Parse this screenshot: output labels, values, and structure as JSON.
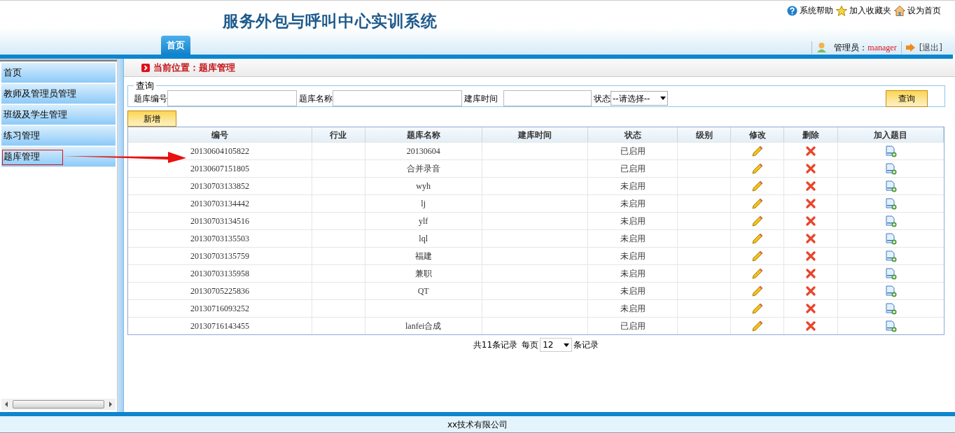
{
  "header": {
    "title": "服务外包与呼叫中心实训系统",
    "links": [
      {
        "kind": "help",
        "label": "系统帮助"
      },
      {
        "kind": "favorite",
        "label": "加入收藏夹"
      },
      {
        "kind": "home",
        "label": "设为首页"
      }
    ],
    "tabs": [
      {
        "label": "首页",
        "selected": true
      }
    ],
    "user": {
      "label": "管理员：",
      "name": "manager",
      "logout": "[退出]"
    }
  },
  "sidebar": {
    "items": [
      {
        "label": "首页",
        "marked": false
      },
      {
        "label": "教师及管理员管理",
        "marked": false
      },
      {
        "label": "班级及学生管理",
        "marked": false
      },
      {
        "label": "练习管理",
        "marked": false
      },
      {
        "label": "题库管理",
        "marked": true
      }
    ]
  },
  "breadcrumb": "当前位置：题库管理",
  "query": {
    "legend": "查询",
    "fields": [
      {
        "kind": "text",
        "label": "题库编号"
      },
      {
        "kind": "text",
        "label": "题库名称"
      },
      {
        "kind": "text",
        "label": "建库时间"
      },
      {
        "kind": "select",
        "label": "状态",
        "value": "--请选择--"
      }
    ],
    "button": "查询"
  },
  "add_button": "新增",
  "table": {
    "columns": [
      "编号",
      "行业",
      "题库名称",
      "建库时间",
      "状态",
      "级别",
      "修改",
      "删除",
      "加入题目"
    ],
    "rows": [
      {
        "id": "20130604105822",
        "name": "20130604",
        "status": "已启用"
      },
      {
        "id": "20130607151805",
        "name": "合并录音",
        "status": "已启用"
      },
      {
        "id": "20130703133852",
        "name": "wyh",
        "status": "未启用"
      },
      {
        "id": "20130703134442",
        "name": "lj",
        "status": "未启用"
      },
      {
        "id": "20130703134516",
        "name": "ylf",
        "status": "未启用"
      },
      {
        "id": "20130703135503",
        "name": "lql",
        "status": "未启用"
      },
      {
        "id": "20130703135759",
        "name": "福建",
        "status": "未启用"
      },
      {
        "id": "20130703135958",
        "name": "兼职",
        "status": "未启用"
      },
      {
        "id": "20130705225836",
        "name": "QT",
        "status": "未启用"
      },
      {
        "id": "20130716093252",
        "status": "未启用"
      },
      {
        "id": "20130716143455",
        "name": "lanfei合成",
        "status": "已启用"
      }
    ]
  },
  "pager": {
    "total": "共11条记录",
    "per_page_label": "每页",
    "per_page": "12",
    "suffix": "条记录"
  },
  "footer": "xx技术有限公司"
}
